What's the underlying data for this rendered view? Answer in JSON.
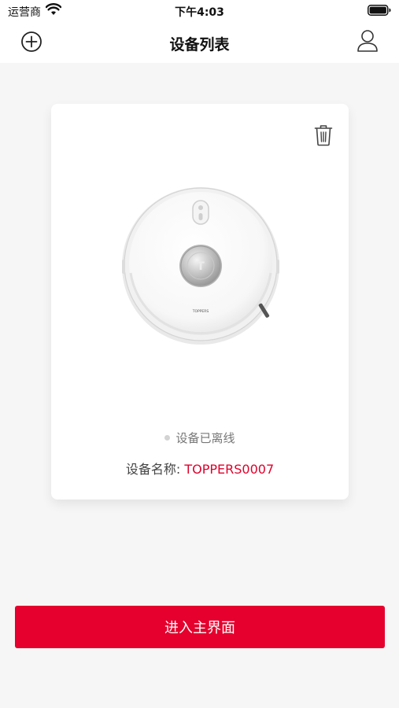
{
  "status_bar": {
    "carrier": "运营商",
    "time": "下午4:03"
  },
  "navbar": {
    "title": "设备列表",
    "left_icon": "plus-circle-icon",
    "right_icon": "user-icon"
  },
  "device_card": {
    "delete_icon": "trash-icon",
    "status": "设备已离线",
    "name_label": "设备名称: ",
    "name_value": "TOPPERS0007",
    "image_logo_text": "TOPPERS"
  },
  "enter_button": {
    "label": "进入主界面"
  },
  "colors": {
    "accent": "#e5002d",
    "background": "#f6f6f6",
    "card": "#ffffff",
    "offline_dot": "#d3d3d3"
  }
}
